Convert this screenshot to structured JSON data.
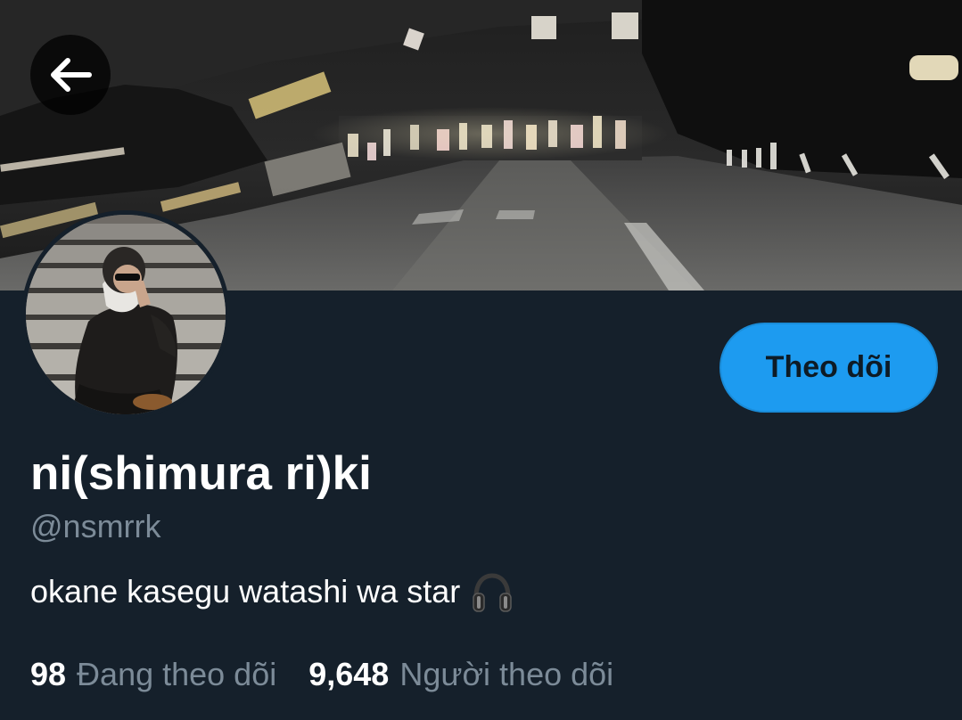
{
  "header": {
    "back_icon": "arrow-left-icon",
    "banner_description_icon": "night-road-photo"
  },
  "profile": {
    "display_name": "ni(shimura ri)ki",
    "handle": "@nsmrrk",
    "bio_text": "okane kasegu watashi wa star",
    "bio_emoji_icon": "headphones-icon",
    "follow_label": "Theo dõi"
  },
  "stats": {
    "following_count": "98",
    "following_label": "Đang theo dõi",
    "followers_count": "9,648",
    "followers_label": "Người theo dõi"
  },
  "colors": {
    "background": "#15202b",
    "accent": "#1d9bf0",
    "muted_text": "#7c8b98",
    "primary_text": "#ffffff"
  }
}
